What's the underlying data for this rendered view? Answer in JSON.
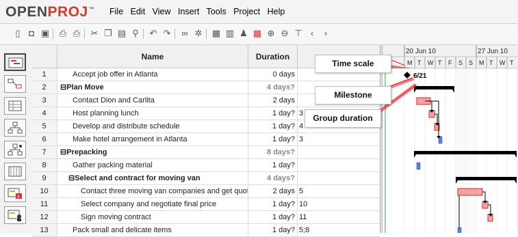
{
  "app": {
    "logo_main": "OPEN",
    "logo_accent": "PROJ",
    "logo_tm": "™",
    "brand_color": "#d33b2c"
  },
  "menu": [
    "File",
    "Edit",
    "View",
    "Insert",
    "Tools",
    "Project",
    "Help"
  ],
  "toolbar_icons": [
    "new-icon",
    "open-icon",
    "save-icon",
    "print-icon",
    "print-preview-icon",
    "cut-icon",
    "copy-icon",
    "paste-icon",
    "find-icon",
    "undo-icon",
    "redo-icon",
    "link-icon",
    "unlink-icon",
    "task-info-icon",
    "notes-icon",
    "assign-resources-icon",
    "gantt-icon",
    "zoom-in-icon",
    "zoom-out-icon",
    "indent-icon",
    "scroll-left-icon",
    "scroll-right-icon"
  ],
  "view_buttons": [
    "gantt-view",
    "network-view",
    "resources-view",
    "wbs-view",
    "rbs-view",
    "report-view",
    "task-usage-view",
    "resource-usage-view"
  ],
  "table": {
    "headers": {
      "num": "",
      "name": "Name",
      "duration": "Duration",
      "pred": ""
    },
    "rows": [
      {
        "num": "1",
        "name": "Accept job offer in Atlanta",
        "duration": "0 days",
        "pred": "",
        "level": 1,
        "summary": false
      },
      {
        "num": "2",
        "name": "Plan Move",
        "duration": "4 days?",
        "pred": "",
        "level": 0,
        "summary": true,
        "toggle": "⊟"
      },
      {
        "num": "3",
        "name": "Contact Dion and Carlita",
        "duration": "2 days",
        "pred": "",
        "level": 1,
        "summary": false
      },
      {
        "num": "4",
        "name": "Host planning  lunch",
        "duration": "1 day?",
        "pred": "3",
        "level": 1,
        "summary": false
      },
      {
        "num": "5",
        "name": "Develop and distribute schedule",
        "duration": "1 day?",
        "pred": "4",
        "level": 1,
        "summary": false
      },
      {
        "num": "6",
        "name": "Make hotel arrangement in Atlanta",
        "duration": "1 day?",
        "pred": "3",
        "level": 1,
        "summary": false
      },
      {
        "num": "7",
        "name": "Prepacking",
        "duration": "8 days?",
        "pred": "",
        "level": 0,
        "summary": true,
        "toggle": "⊟"
      },
      {
        "num": "8",
        "name": "Gather packing material",
        "duration": "1 day?",
        "pred": "",
        "level": 1,
        "summary": false
      },
      {
        "num": "9",
        "name": "Select and contract for moving van",
        "duration": "4 days?",
        "pred": "",
        "level": 1,
        "summary": true,
        "toggle": "⊟"
      },
      {
        "num": "10",
        "name": "Contact three moving van companies and get quote",
        "duration": "2 days",
        "pred": "5",
        "level": 2,
        "summary": false
      },
      {
        "num": "11",
        "name": "Select company and negotiate final price",
        "duration": "1 day?",
        "pred": "10",
        "level": 2,
        "summary": false
      },
      {
        "num": "12",
        "name": "Sign moving contract",
        "duration": "1 day?",
        "pred": "11",
        "level": 2,
        "summary": false
      },
      {
        "num": "13",
        "name": "Pack small and delicate items",
        "duration": "1 day?",
        "pred": "5;8",
        "level": 1,
        "summary": false
      }
    ]
  },
  "timescale": {
    "weeks": [
      "20 Jun 10",
      "27 Jun 10"
    ],
    "days": [
      "M",
      "T",
      "W",
      "T",
      "F",
      "S",
      "S",
      "M",
      "T",
      "W",
      "T"
    ]
  },
  "milestone_label": "6/21",
  "callouts": {
    "time_scale": "Time scale",
    "milestone": "Milestone",
    "group_duration": "Group duration"
  },
  "colors": {
    "task_bar_fill": "#f3a0a8",
    "task_bar_border": "#c0392b",
    "progress_bar": "#5a7fd6",
    "summary_bar": "#000000",
    "callout_line": "#e02020"
  }
}
